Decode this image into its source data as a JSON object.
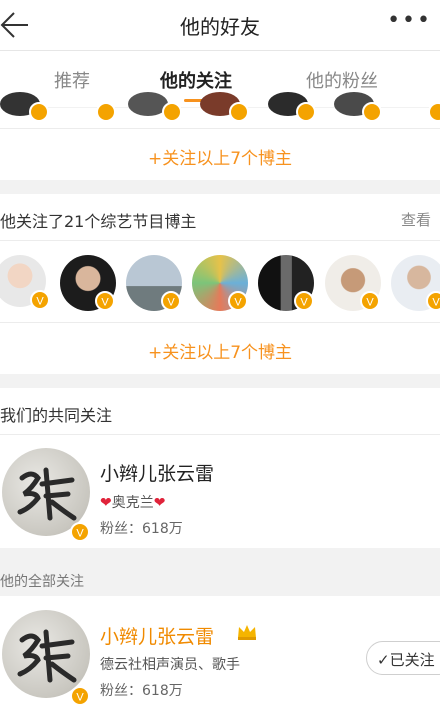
{
  "header": {
    "title": "他的好友",
    "back_icon": "back-arrow-icon",
    "more_icon": "more-dots-icon"
  },
  "tabs": [
    {
      "label": "推荐"
    },
    {
      "label": "他的关注"
    },
    {
      "label": "他的粉丝"
    }
  ],
  "colors": {
    "accent": "#f7921e",
    "verified": "#f4a300",
    "heart": "#e0233a"
  },
  "top_group": {
    "follow_all": "+关注以上7个博主"
  },
  "variety_group": {
    "title": "他关注了21个综艺节目博主",
    "view": "查看",
    "follow_all": "+关注以上7个博主"
  },
  "mutual": {
    "title": "我们的共同关注",
    "user": {
      "name": "小辫儿张云雷",
      "heart_left": "❤",
      "tag": "奥克兰",
      "heart_right": "❤",
      "fans": "粉丝：618万"
    }
  },
  "all_following": {
    "title": "他的全部关注",
    "user": {
      "name": "小辫儿张云雷",
      "desc": "德云社相声演员、歌手",
      "fans": "粉丝：618万",
      "followed_label": "已关注"
    }
  }
}
